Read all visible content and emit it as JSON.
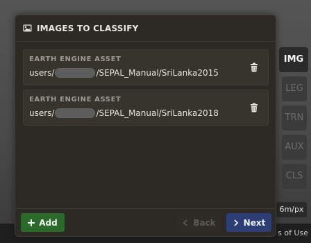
{
  "dialog": {
    "title": "IMAGES TO CLASSIFY",
    "assets": [
      {
        "type_label": "EARTH ENGINE ASSET",
        "path_prefix": "users/",
        "path_suffix": "/SEPAL_Manual/SriLanka2015"
      },
      {
        "type_label": "EARTH ENGINE ASSET",
        "path_prefix": "users/",
        "path_suffix": "/SEPAL_Manual/SriLanka2018"
      }
    ],
    "buttons": {
      "add": "Add",
      "back": "Back",
      "next": "Next"
    }
  },
  "side_tabs": [
    "IMG",
    "LEG",
    "TRN",
    "AUX",
    "CLS"
  ],
  "map": {
    "scale": "6m/px",
    "terms": "s of Use"
  },
  "colors": {
    "panel": "#2d2a26",
    "card": "#37332d",
    "add_button": "#2c6a2c",
    "next_button": "#2d3e74"
  },
  "icons": {
    "header": "image-icon",
    "delete": "trash-icon",
    "add": "plus-icon",
    "back": "chevron-left-icon",
    "next": "chevron-right-icon"
  }
}
